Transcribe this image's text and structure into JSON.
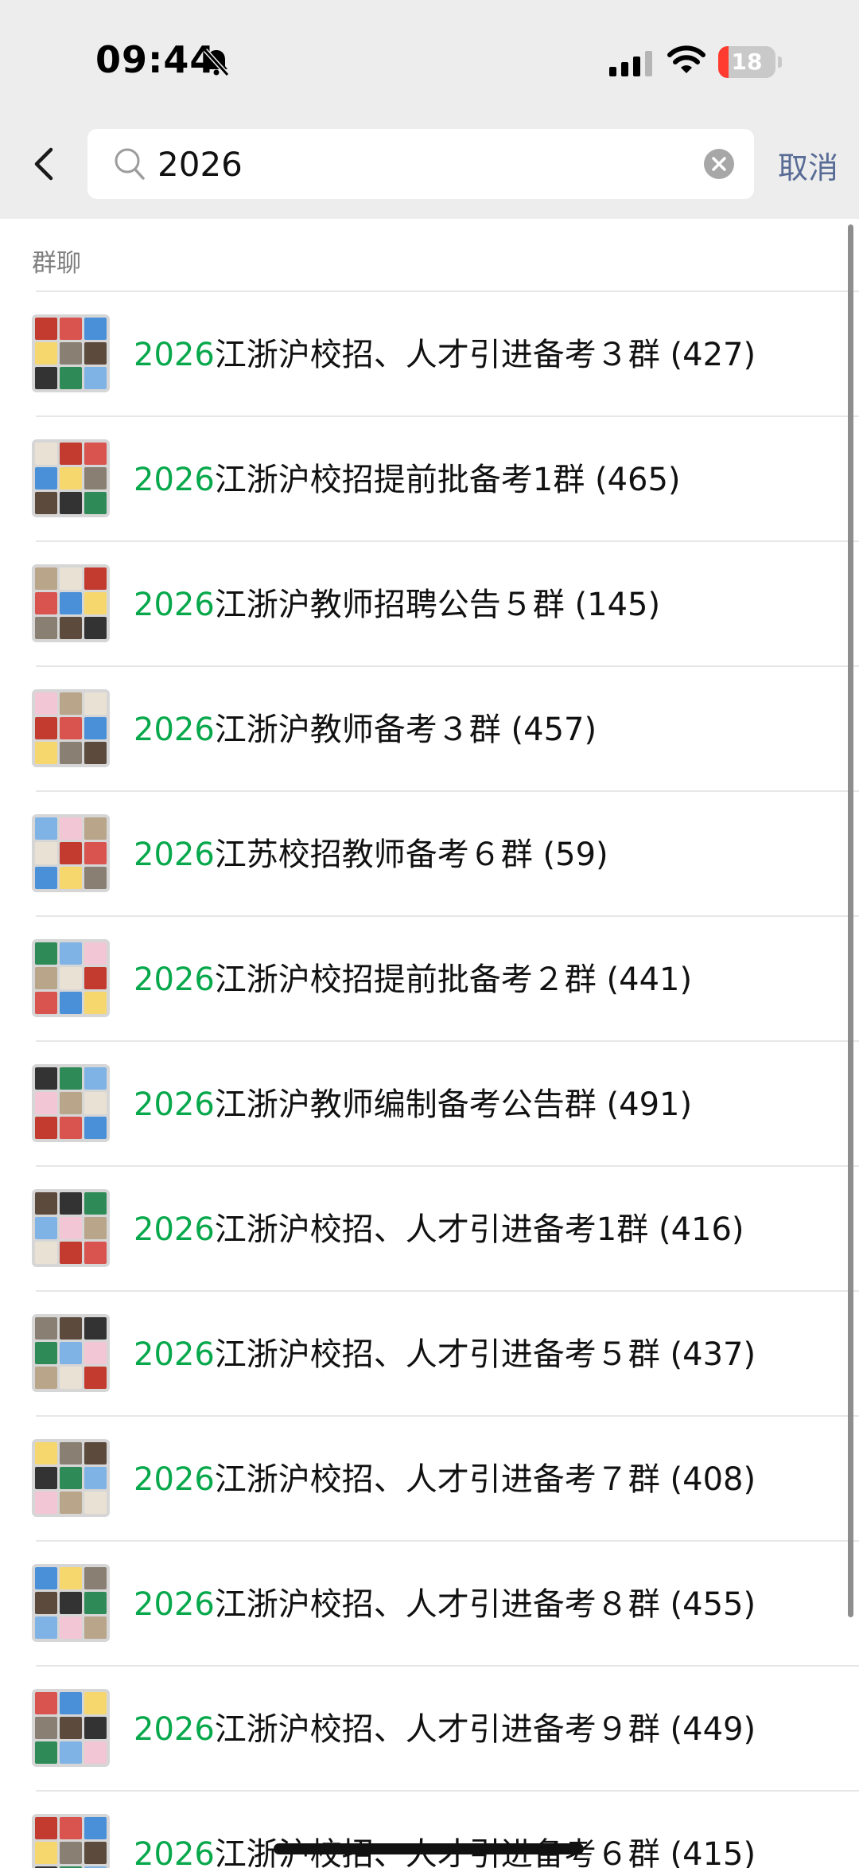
{
  "status_bar": {
    "time": "09:44",
    "battery_level": "18",
    "battery_fraction": 0.18,
    "icons": [
      "bell-slash-icon",
      "cellular-signal-icon",
      "wifi-icon",
      "battery-icon"
    ]
  },
  "search": {
    "query": "2026",
    "placeholder": "",
    "cancel_label": "取消"
  },
  "section": {
    "title": "群聊"
  },
  "results": [
    {
      "highlight": "2026",
      "text": "江浙沪校招、人才引进备考３群 (427)"
    },
    {
      "highlight": "2026",
      "text": "江浙沪校招提前批备考1群 (465)"
    },
    {
      "highlight": "2026",
      "text": "江浙沪教师招聘公告５群 (145)"
    },
    {
      "highlight": "2026",
      "text": "江浙沪教师备考３群 (457)"
    },
    {
      "highlight": "2026",
      "text": "江苏校招教师备考６群 (59)"
    },
    {
      "highlight": "2026",
      "text": "江浙沪校招提前批备考２群 (441)"
    },
    {
      "highlight": "2026",
      "text": "江浙沪教师编制备考公告群 (491)"
    },
    {
      "highlight": "2026",
      "text": "江浙沪校招、人才引进备考1群 (416)"
    },
    {
      "highlight": "2026",
      "text": "江浙沪校招、人才引进备考５群 (437)"
    },
    {
      "highlight": "2026",
      "text": "江浙沪校招、人才引进备考７群 (408)"
    },
    {
      "highlight": "2026",
      "text": "江浙沪校招、人才引进备考８群 (455)"
    },
    {
      "highlight": "2026",
      "text": "江浙沪校招、人才引进备考９群 (449)"
    },
    {
      "highlight": "2026",
      "text": "江浙沪校招、人才引进备考６群 (415)"
    }
  ],
  "colors": {
    "highlight": "#07a84b",
    "link": "#576b95",
    "background": "#ededed",
    "battery_low": "#ff3b30"
  }
}
